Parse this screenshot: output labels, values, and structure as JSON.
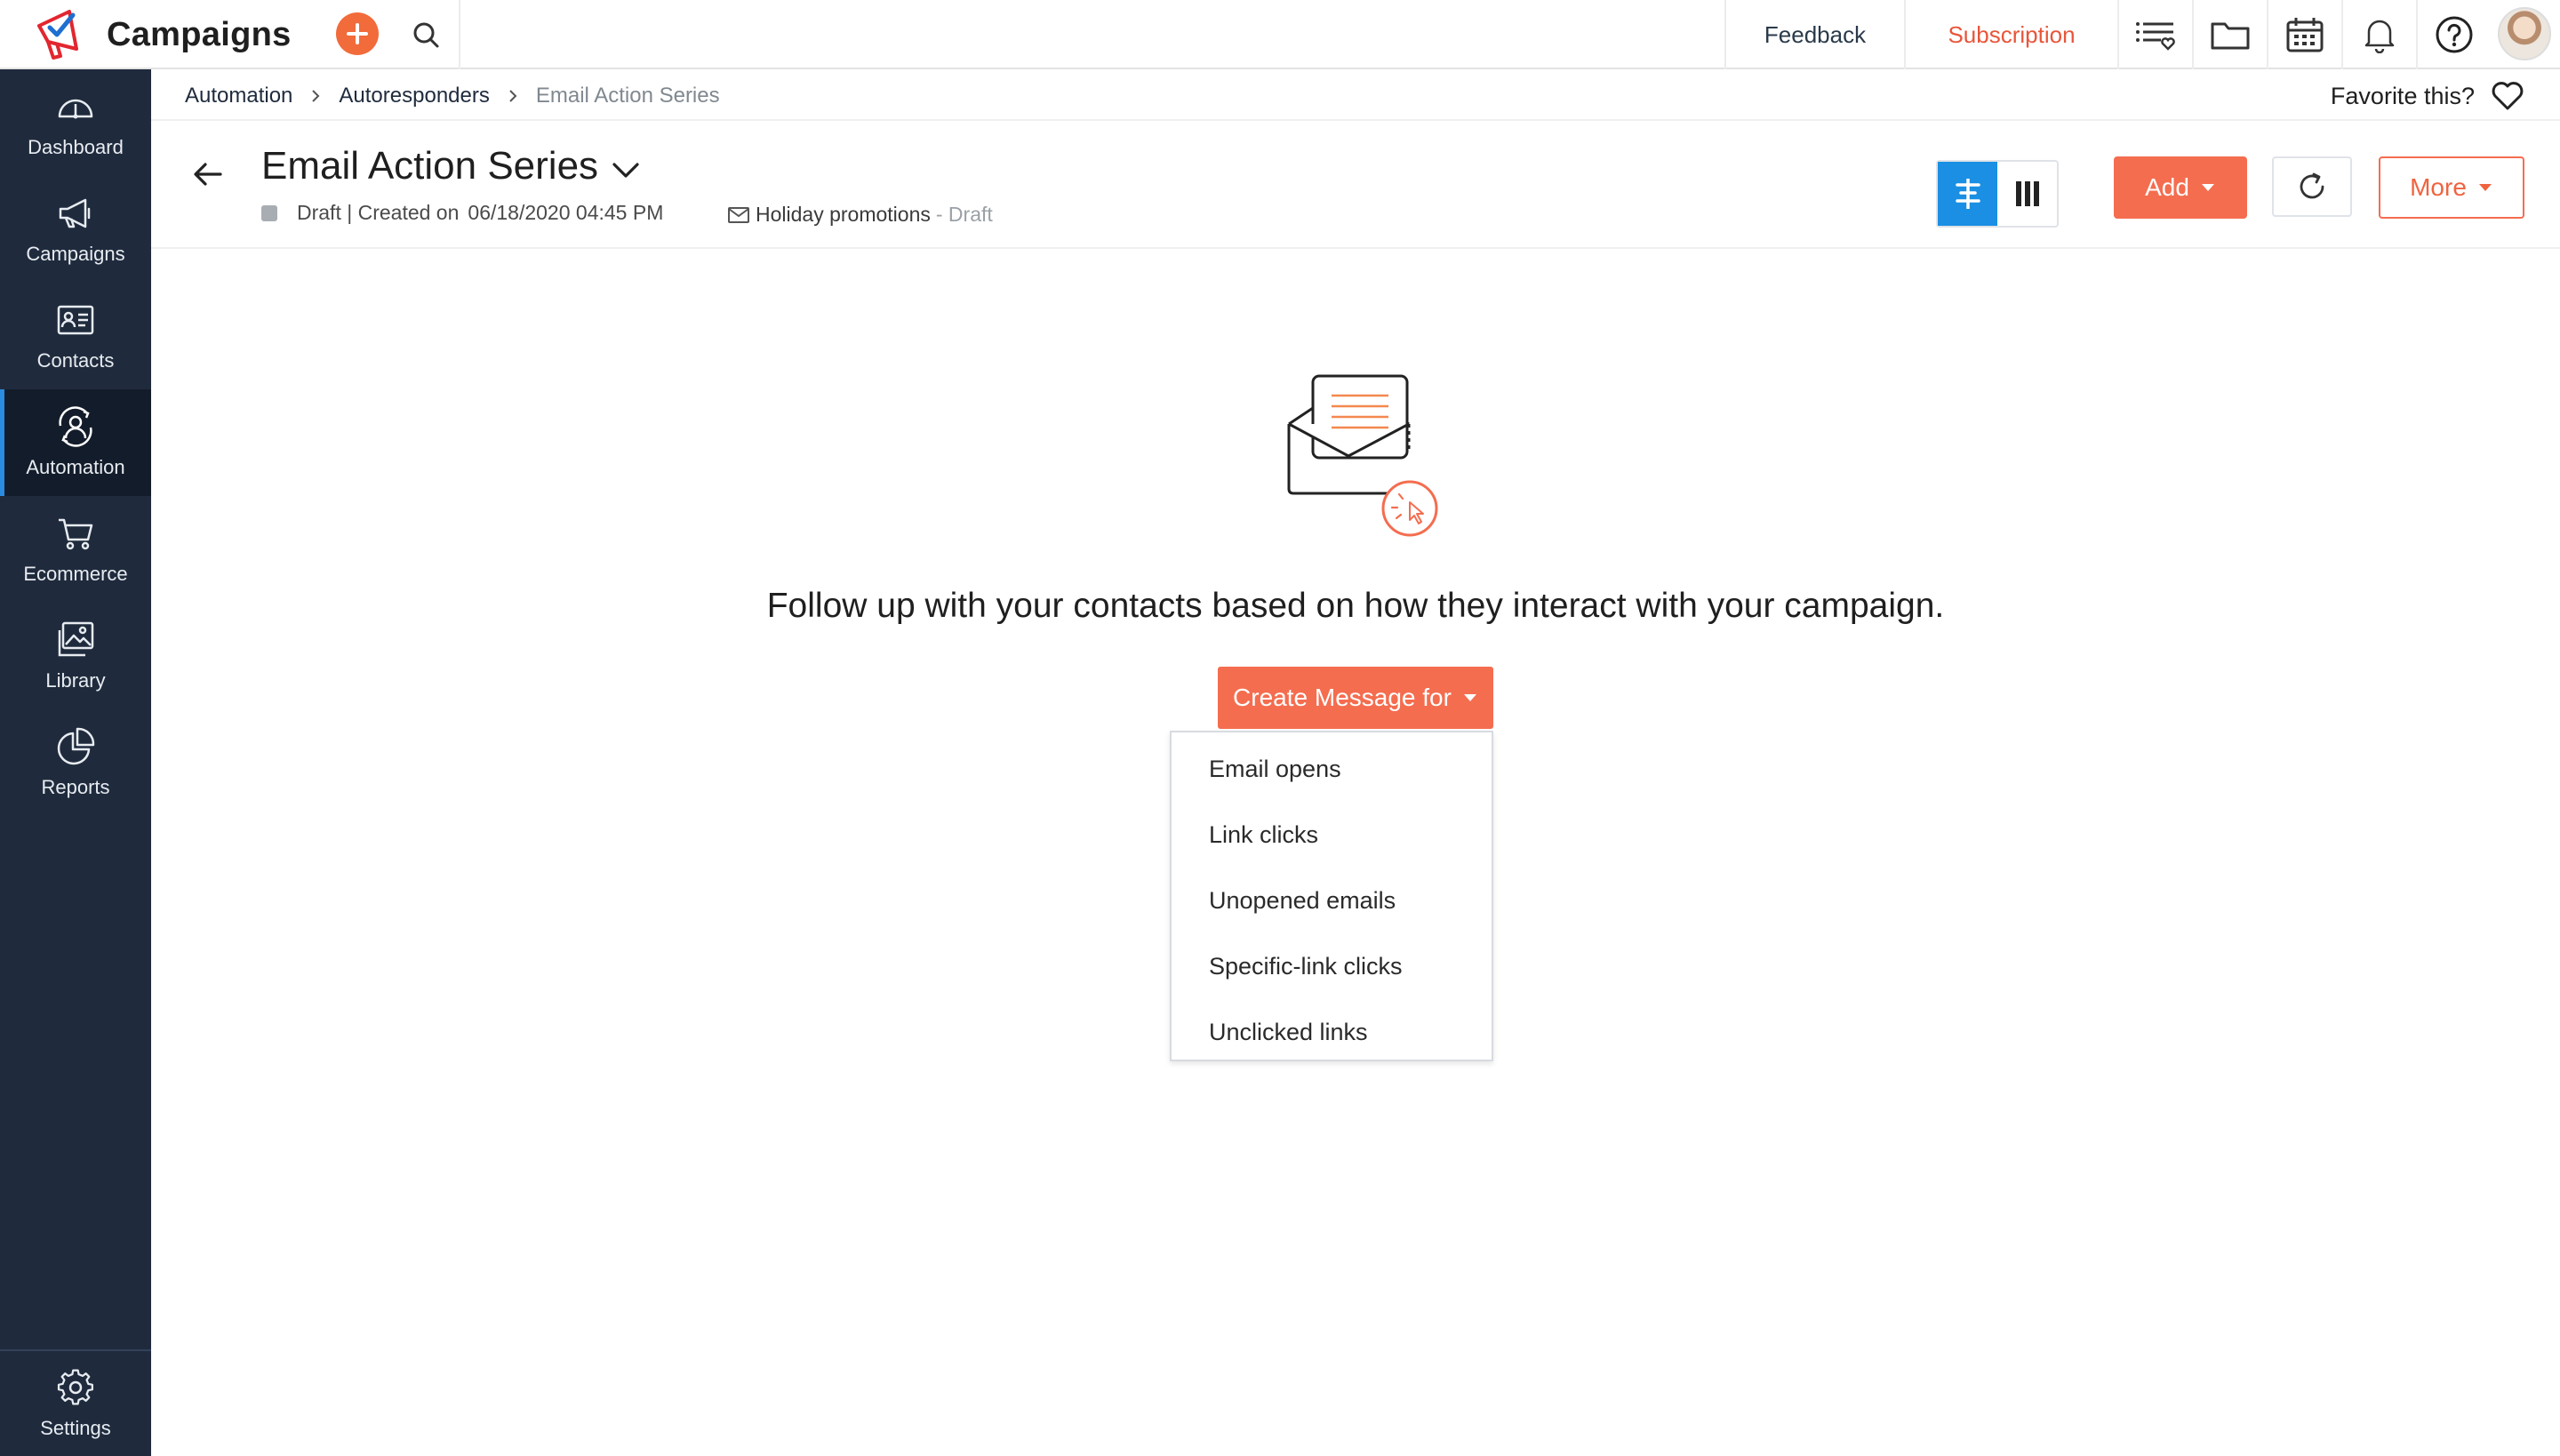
{
  "app": {
    "name": "Campaigns"
  },
  "topbar": {
    "feedback": "Feedback",
    "subscription": "Subscription",
    "icons": [
      "plus-icon",
      "search-icon",
      "list-heart-icon",
      "folder-icon",
      "calendar-icon",
      "bell-icon",
      "help-icon",
      "avatar"
    ]
  },
  "sidebar": {
    "items": [
      {
        "label": "Dashboard",
        "icon": "dashboard-icon"
      },
      {
        "label": "Campaigns",
        "icon": "megaphone-icon"
      },
      {
        "label": "Contacts",
        "icon": "contact-card-icon"
      },
      {
        "label": "Automation",
        "icon": "automation-icon",
        "active": true
      },
      {
        "label": "Ecommerce",
        "icon": "cart-icon"
      },
      {
        "label": "Library",
        "icon": "image-library-icon"
      },
      {
        "label": "Reports",
        "icon": "pie-chart-icon"
      }
    ],
    "settings": "Settings"
  },
  "breadcrumb": {
    "items": [
      "Automation",
      "Autoresponders"
    ],
    "current": "Email Action Series"
  },
  "favorite": {
    "label": "Favorite this?"
  },
  "header": {
    "title": "Email Action Series",
    "status": "Draft | Created on",
    "created": "06/18/2020 04:45 PM",
    "list_name": "Holiday promotions",
    "list_status": "- Draft",
    "add_label": "Add",
    "more_label": "More"
  },
  "main": {
    "empty_message": "Follow up with your contacts based on how they interact with your campaign.",
    "create_label": "Create Message for",
    "dropdown_options": [
      "Email opens",
      "Link clicks",
      "Unopened emails",
      "Specific-link clicks",
      "Unclicked links"
    ]
  },
  "colors": {
    "accent": "#f46d4f",
    "sidebar_bg": "#1f2b3d",
    "active_view": "#1a8fe3",
    "subscription": "#e8553a"
  }
}
